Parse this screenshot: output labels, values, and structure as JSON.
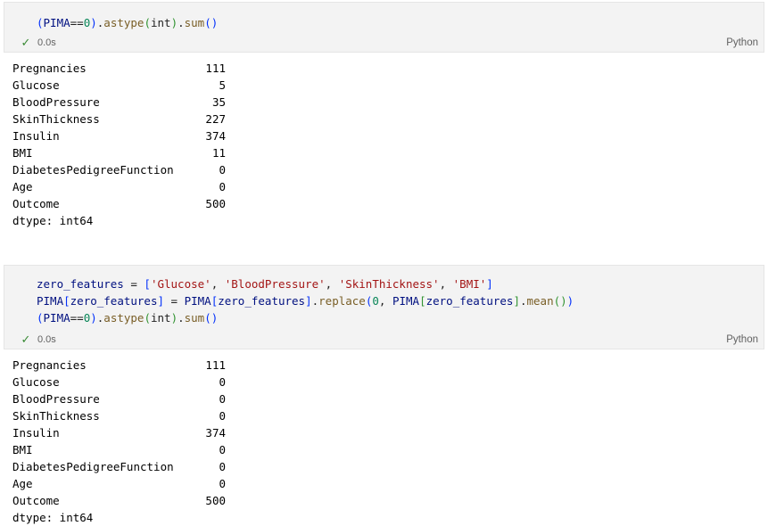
{
  "cells": [
    {
      "code_lines": [
        [
          {
            "t": "(",
            "c": "paren1"
          },
          {
            "t": "PIMA",
            "c": "var"
          },
          {
            "t": "==",
            "c": "default"
          },
          {
            "t": "0",
            "c": "number"
          },
          {
            "t": ")",
            "c": "paren1"
          },
          {
            "t": ".",
            "c": "default"
          },
          {
            "t": "astype",
            "c": "method"
          },
          {
            "t": "(",
            "c": "paren2"
          },
          {
            "t": "int",
            "c": "default"
          },
          {
            "t": ")",
            "c": "paren2"
          },
          {
            "t": ".",
            "c": "default"
          },
          {
            "t": "sum",
            "c": "method"
          },
          {
            "t": "()",
            "c": "paren1"
          }
        ]
      ],
      "exec_time": "0.0s",
      "language": "Python",
      "output": {
        "rows": [
          {
            "key": "Pregnancies",
            "value": "111"
          },
          {
            "key": "Glucose",
            "value": "5"
          },
          {
            "key": "BloodPressure",
            "value": "35"
          },
          {
            "key": "SkinThickness",
            "value": "227"
          },
          {
            "key": "Insulin",
            "value": "374"
          },
          {
            "key": "BMI",
            "value": "11"
          },
          {
            "key": "DiabetesPedigreeFunction",
            "value": "0"
          },
          {
            "key": "Age",
            "value": "0"
          },
          {
            "key": "Outcome",
            "value": "500"
          }
        ],
        "dtype": "dtype: int64"
      }
    },
    {
      "code_lines": [
        [
          {
            "t": "zero_features",
            "c": "var"
          },
          {
            "t": " = ",
            "c": "default"
          },
          {
            "t": "[",
            "c": "paren1"
          },
          {
            "t": "'Glucose'",
            "c": "string"
          },
          {
            "t": ", ",
            "c": "default"
          },
          {
            "t": "'BloodPressure'",
            "c": "string"
          },
          {
            "t": ", ",
            "c": "default"
          },
          {
            "t": "'SkinThickness'",
            "c": "string"
          },
          {
            "t": ", ",
            "c": "default"
          },
          {
            "t": "'BMI'",
            "c": "string"
          },
          {
            "t": "]",
            "c": "paren1"
          }
        ],
        [
          {
            "t": "PIMA",
            "c": "var"
          },
          {
            "t": "[",
            "c": "paren1"
          },
          {
            "t": "zero_features",
            "c": "var"
          },
          {
            "t": "]",
            "c": "paren1"
          },
          {
            "t": " = ",
            "c": "default"
          },
          {
            "t": "PIMA",
            "c": "var"
          },
          {
            "t": "[",
            "c": "paren1"
          },
          {
            "t": "zero_features",
            "c": "var"
          },
          {
            "t": "]",
            "c": "paren1"
          },
          {
            "t": ".",
            "c": "default"
          },
          {
            "t": "replace",
            "c": "method"
          },
          {
            "t": "(",
            "c": "paren1"
          },
          {
            "t": "0",
            "c": "number"
          },
          {
            "t": ", ",
            "c": "default"
          },
          {
            "t": "PIMA",
            "c": "var"
          },
          {
            "t": "[",
            "c": "paren2"
          },
          {
            "t": "zero_features",
            "c": "var"
          },
          {
            "t": "]",
            "c": "paren2"
          },
          {
            "t": ".",
            "c": "default"
          },
          {
            "t": "mean",
            "c": "method"
          },
          {
            "t": "()",
            "c": "paren2"
          },
          {
            "t": ")",
            "c": "paren1"
          }
        ],
        [
          {
            "t": "(",
            "c": "paren1"
          },
          {
            "t": "PIMA",
            "c": "var"
          },
          {
            "t": "==",
            "c": "default"
          },
          {
            "t": "0",
            "c": "number"
          },
          {
            "t": ")",
            "c": "paren1"
          },
          {
            "t": ".",
            "c": "default"
          },
          {
            "t": "astype",
            "c": "method"
          },
          {
            "t": "(",
            "c": "paren2"
          },
          {
            "t": "int",
            "c": "default"
          },
          {
            "t": ")",
            "c": "paren2"
          },
          {
            "t": ".",
            "c": "default"
          },
          {
            "t": "sum",
            "c": "method"
          },
          {
            "t": "()",
            "c": "paren1"
          }
        ]
      ],
      "exec_time": "0.0s",
      "language": "Python",
      "output": {
        "rows": [
          {
            "key": "Pregnancies",
            "value": "111"
          },
          {
            "key": "Glucose",
            "value": "0"
          },
          {
            "key": "BloodPressure",
            "value": "0"
          },
          {
            "key": "SkinThickness",
            "value": "0"
          },
          {
            "key": "Insulin",
            "value": "374"
          },
          {
            "key": "BMI",
            "value": "0"
          },
          {
            "key": "DiabetesPedigreeFunction",
            "value": "0"
          },
          {
            "key": "Age",
            "value": "0"
          },
          {
            "key": "Outcome",
            "value": "500"
          }
        ],
        "dtype": "dtype: int64"
      }
    }
  ],
  "icons": {
    "status_success": "check-icon",
    "success_color": "#388a34"
  }
}
